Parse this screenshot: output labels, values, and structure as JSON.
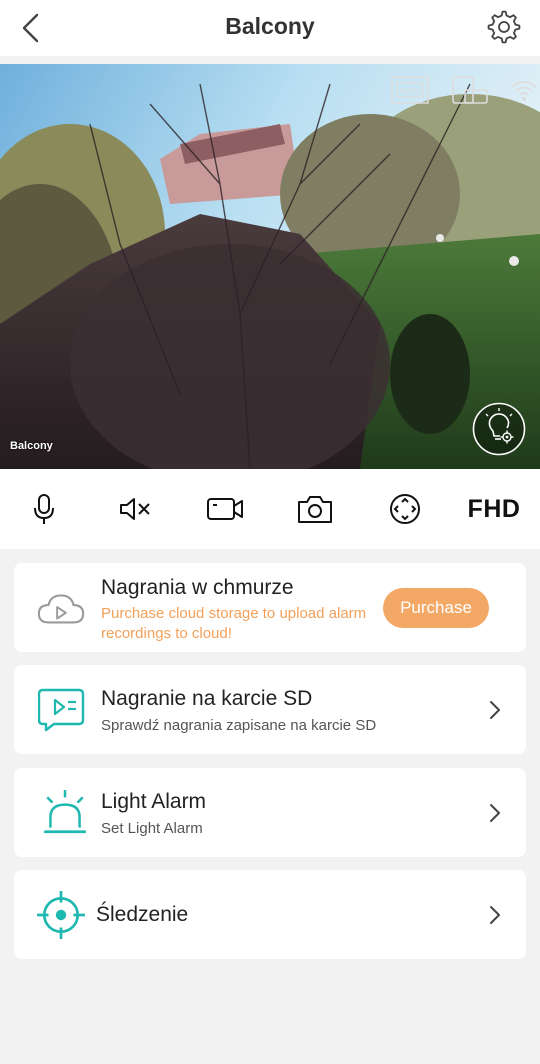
{
  "header": {
    "title": "Balcony"
  },
  "video": {
    "camera_label": "Balcony",
    "osd_auto_label": "AUTO"
  },
  "toolbar": {
    "quality_label": "FHD"
  },
  "cards": {
    "cloud": {
      "title": "Nagrania w chmurze",
      "subtitle": "Purchase cloud storage to upload alarm recordings to cloud!",
      "button_label": "Purchase"
    },
    "sd": {
      "title": "Nagranie na karcie SD",
      "subtitle": "Sprawdź nagrania zapisane na karcie SD"
    },
    "light_alarm": {
      "title": "Light Alarm",
      "subtitle": "Set Light Alarm"
    },
    "tracking": {
      "title": "Śledzenie"
    }
  },
  "colors": {
    "accent_teal": "#1fb8b0",
    "purchase_orange": "#f4a866",
    "promo_text_orange": "#f2a05a",
    "background": "#f2f2f2"
  },
  "icons": {
    "back": "chevron-left-icon",
    "settings": "gear-icon",
    "microphone": "microphone-icon",
    "mute": "speaker-mute-icon",
    "record": "video-record-icon",
    "snapshot": "camera-icon",
    "ptz": "ptz-direction-icon",
    "cloud": "cloud-play-icon",
    "sd_card": "sd-playback-icon",
    "light_alarm": "siren-icon",
    "tracking": "crosshair-icon",
    "light": "lightbulb-settings-icon"
  }
}
